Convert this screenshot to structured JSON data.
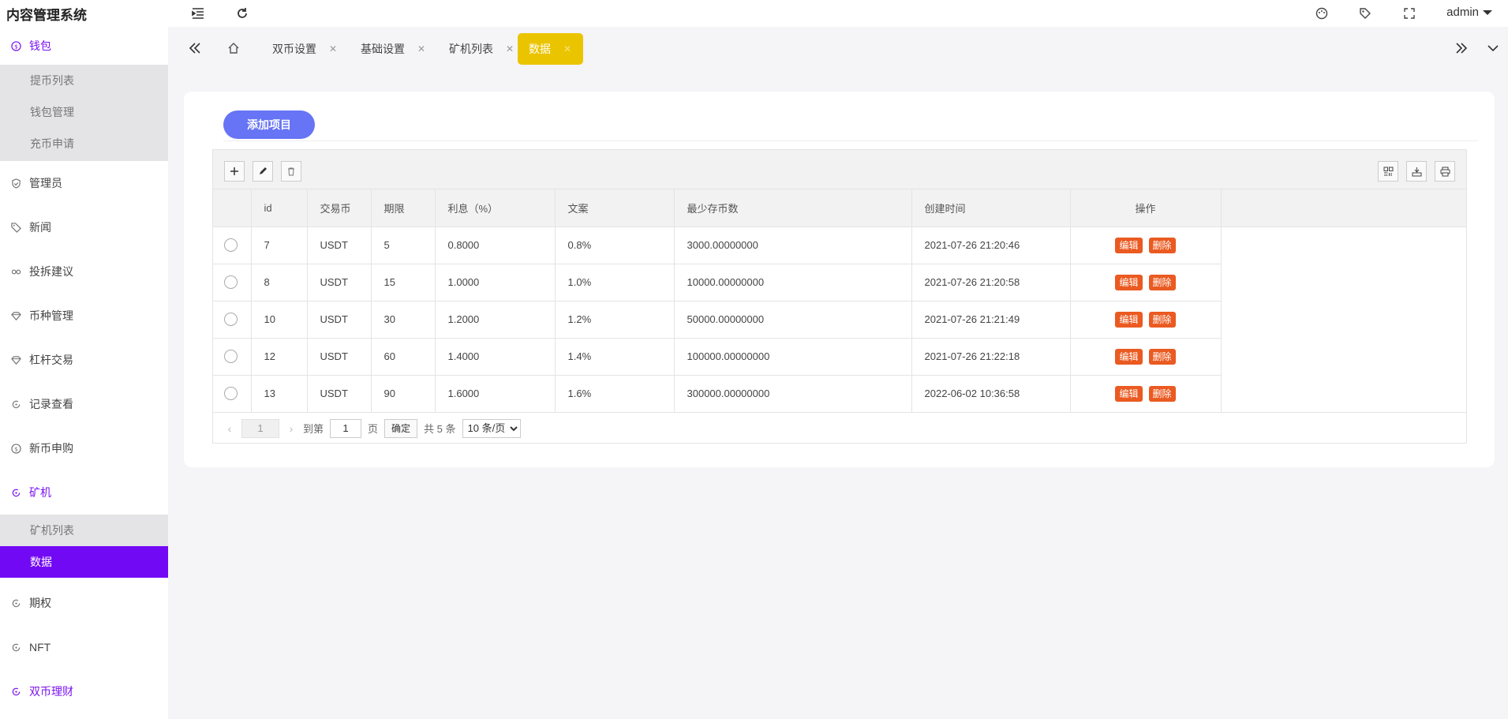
{
  "header": {
    "title": "内容管理系统",
    "user": "admin",
    "icons": [
      "menu-fold-icon",
      "refresh-icon",
      "palette-icon",
      "tag-icon",
      "fullscreen-icon"
    ]
  },
  "sidebar": {
    "groups": [
      {
        "label": "钱包",
        "icon": "dollar-icon",
        "open": true,
        "items": [
          {
            "label": "提币列表"
          },
          {
            "label": "钱包管理"
          },
          {
            "label": "充币申请"
          }
        ]
      },
      {
        "label": "管理员",
        "icon": "shield-icon"
      },
      {
        "label": "新闻",
        "icon": "tag-icon"
      },
      {
        "label": "投拆建议",
        "icon": "link-icon"
      },
      {
        "label": "币种管理",
        "icon": "diamond-icon"
      },
      {
        "label": "杠杆交易",
        "icon": "diamond-icon"
      },
      {
        "label": "记录查看",
        "icon": "refresh-icon"
      },
      {
        "label": "新币申购",
        "icon": "dollar-icon"
      },
      {
        "label": "矿机",
        "icon": "refresh-icon",
        "open": true,
        "items": [
          {
            "label": "矿机列表"
          },
          {
            "label": "数据",
            "active": true
          }
        ]
      },
      {
        "label": "期权",
        "icon": "refresh-icon"
      },
      {
        "label": "NFT",
        "icon": "refresh-icon"
      },
      {
        "label": "双币理财",
        "icon": "refresh-icon",
        "highlight": true
      }
    ]
  },
  "tabs": [
    {
      "label": "双币设置"
    },
    {
      "label": "基础设置"
    },
    {
      "label": "矿机列表"
    },
    {
      "label": "数据",
      "active": true
    }
  ],
  "main": {
    "add_label": "添加项目",
    "columns": [
      "id",
      "交易币",
      "期限",
      "利息（%）",
      "文案",
      "最少存币数",
      "创建时间",
      "操作"
    ],
    "edit_label": "编辑",
    "delete_label": "删除",
    "rows": [
      {
        "id": "7",
        "coin": "USDT",
        "term": "5",
        "rate": "0.8000",
        "text": "0.8%",
        "min": "3000.00000000",
        "created": "2021-07-26 21:20:46"
      },
      {
        "id": "8",
        "coin": "USDT",
        "term": "15",
        "rate": "1.0000",
        "text": "1.0%",
        "min": "10000.00000000",
        "created": "2021-07-26 21:20:58"
      },
      {
        "id": "10",
        "coin": "USDT",
        "term": "30",
        "rate": "1.2000",
        "text": "1.2%",
        "min": "50000.00000000",
        "created": "2021-07-26 21:21:49"
      },
      {
        "id": "12",
        "coin": "USDT",
        "term": "60",
        "rate": "1.4000",
        "text": "1.4%",
        "min": "100000.00000000",
        "created": "2021-07-26 21:22:18"
      },
      {
        "id": "13",
        "coin": "USDT",
        "term": "90",
        "rate": "1.6000",
        "text": "1.6%",
        "min": "300000.00000000",
        "created": "2022-06-02 10:36:58"
      }
    ],
    "pager": {
      "current": "1",
      "goto_label": "到第",
      "goto_value": "1",
      "page_label": "页",
      "confirm_label": "确定",
      "total_label": "共 5 条",
      "size_option": "10 条/页"
    }
  }
}
